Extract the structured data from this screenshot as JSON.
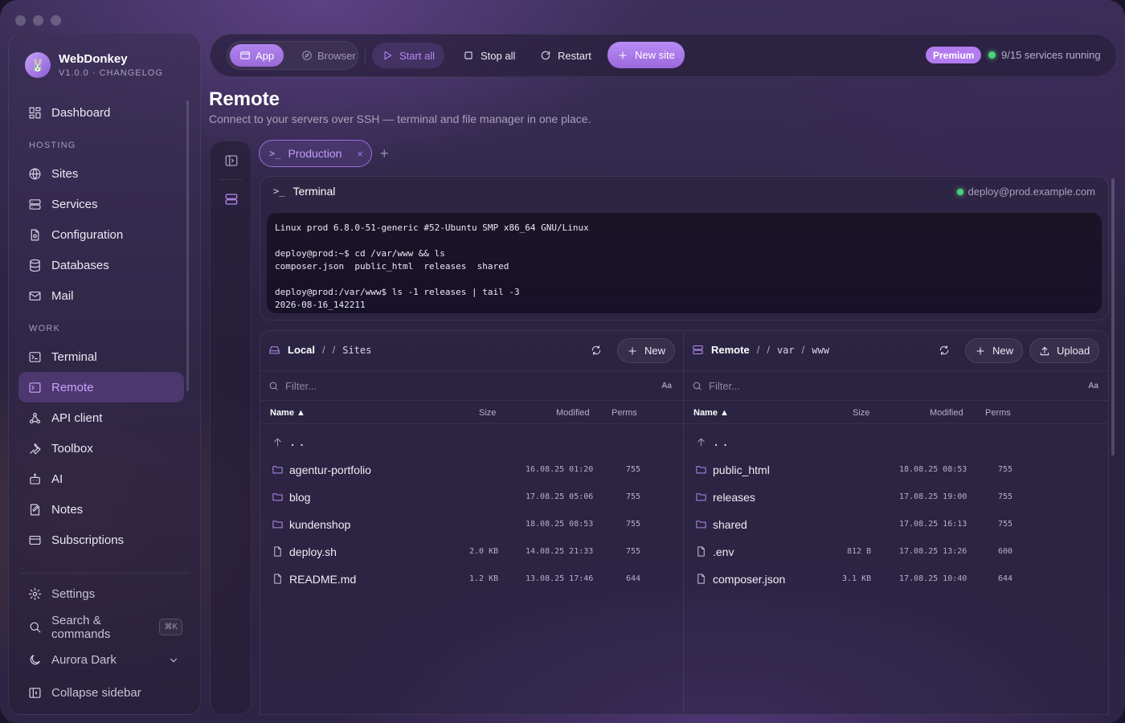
{
  "app": {
    "name": "WebDonkey",
    "version": "V1.0.0 · CHANGELOG",
    "logo_glyph": "🐰"
  },
  "sidebar": {
    "top_items": [
      {
        "label": "Dashboard",
        "icon": "dashboard-icon"
      }
    ],
    "hosting_label": "HOSTING",
    "hosting_items": [
      {
        "label": "Sites",
        "icon": "globe-icon"
      },
      {
        "label": "Services",
        "icon": "server-icon"
      },
      {
        "label": "Configuration",
        "icon": "config-file-icon"
      },
      {
        "label": "Databases",
        "icon": "database-icon"
      },
      {
        "label": "Mail",
        "icon": "mail-icon"
      }
    ],
    "work_label": "WORK",
    "work_items": [
      {
        "label": "Terminal",
        "icon": "terminal-icon"
      },
      {
        "label": "Remote",
        "icon": "remote-icon",
        "active": true
      },
      {
        "label": "API client",
        "icon": "api-icon"
      },
      {
        "label": "Toolbox",
        "icon": "wrench-icon"
      },
      {
        "label": "AI",
        "icon": "robot-icon"
      },
      {
        "label": "Notes",
        "icon": "notes-icon"
      },
      {
        "label": "Subscriptions",
        "icon": "card-icon"
      }
    ],
    "bottom": {
      "settings": "Settings",
      "search": "Search & commands",
      "search_kbd": "⌘K",
      "theme": "Aurora Dark",
      "collapse": "Collapse sidebar"
    }
  },
  "toolbar": {
    "app": "App",
    "browser": "Browser",
    "start_all": "Start all",
    "stop_all": "Stop all",
    "restart": "Restart",
    "new_site": "New site",
    "premium": "Premium",
    "status": "9/15 services running"
  },
  "page": {
    "title": "Remote",
    "subtitle": "Connect to your servers over SSH — terminal and file manager in one place."
  },
  "tabs": {
    "active": "Production",
    "close": "×",
    "add": "+"
  },
  "terminal": {
    "title": "Terminal",
    "user": "deploy@prod.example.com",
    "output": "Linux prod 6.8.0-51-generic #52-Ubuntu SMP x86_64 GNU/Linux\n\ndeploy@prod:~$ cd /var/www && ls\ncomposer.json  public_html  releases  shared\n\ndeploy@prod:/var/www$ ls -1 releases | tail -3\n2026-08-16_142211"
  },
  "local": {
    "root": "Local",
    "sep": "/",
    "path": [
      "Sites"
    ],
    "new": "New",
    "filter_placeholder": "Filter...",
    "aa": "Aa",
    "cols": {
      "name": "Name ▲",
      "size": "Size",
      "modified": "Modified",
      "perms": "Perms"
    },
    "up": "..",
    "rows": [
      {
        "name": "agentur-portfolio",
        "type": "folder",
        "size": "",
        "modified": "16.08.25 01:20",
        "perms": "755"
      },
      {
        "name": "blog",
        "type": "folder",
        "size": "",
        "modified": "17.08.25 05:06",
        "perms": "755"
      },
      {
        "name": "kundenshop",
        "type": "folder",
        "size": "",
        "modified": "18.08.25 08:53",
        "perms": "755"
      },
      {
        "name": "deploy.sh",
        "type": "file",
        "size": "2.0 KB",
        "modified": "14.08.25 21:33",
        "perms": "755"
      },
      {
        "name": "README.md",
        "type": "file",
        "size": "1.2 KB",
        "modified": "13.08.25 17:46",
        "perms": "644"
      }
    ]
  },
  "remote": {
    "root": "Remote",
    "sep": "/",
    "path": [
      "var",
      "www"
    ],
    "new": "New",
    "upload": "Upload",
    "filter_placeholder": "Filter...",
    "aa": "Aa",
    "cols": {
      "name": "Name ▲",
      "size": "Size",
      "modified": "Modified",
      "perms": "Perms"
    },
    "up": "..",
    "rows": [
      {
        "name": "public_html",
        "type": "folder",
        "size": "",
        "modified": "18.08.25 08:53",
        "perms": "755"
      },
      {
        "name": "releases",
        "type": "folder",
        "size": "",
        "modified": "17.08.25 19:00",
        "perms": "755"
      },
      {
        "name": "shared",
        "type": "folder",
        "size": "",
        "modified": "17.08.25 16:13",
        "perms": "755"
      },
      {
        "name": ".env",
        "type": "file",
        "size": "812 B",
        "modified": "17.08.25 13:26",
        "perms": "600"
      },
      {
        "name": "composer.json",
        "type": "file",
        "size": "3.1 KB",
        "modified": "17.08.25 10:40",
        "perms": "644"
      }
    ]
  },
  "colors": {
    "accent": "#b27cf0",
    "accent_text": "#c9a3ff",
    "running": "#4cd07a"
  }
}
